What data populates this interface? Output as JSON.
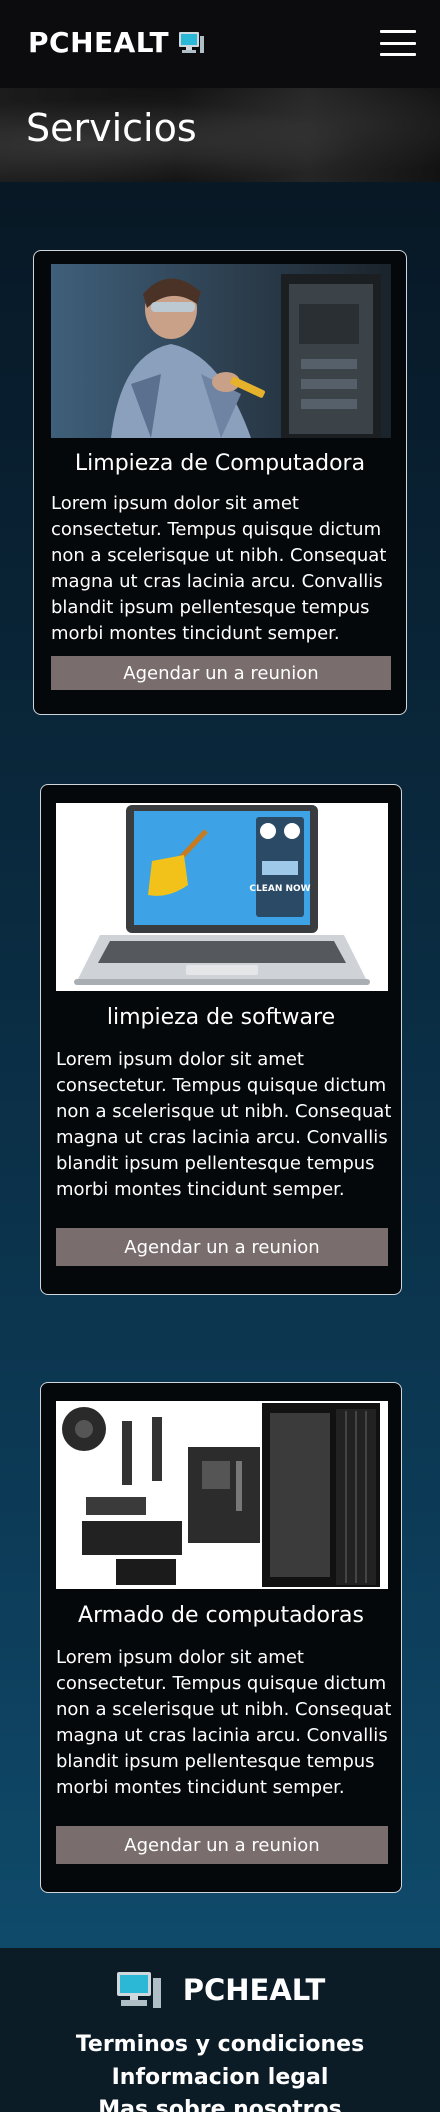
{
  "header": {
    "brand": "PCHEALT",
    "menu_icon": "hamburger-menu-icon"
  },
  "hero": {
    "title": "Servicios"
  },
  "services": [
    {
      "title": "Limpieza de Computadora",
      "text": "Lorem ipsum dolor sit amet consectetur. Tempus quisque dictum non a scelerisque ut nibh. Consequat magna ut cras lacinia arcu. Convallis blandit ipsum pellentesque tempus morbi montes tincidunt semper.",
      "button": "Agendar un a reunion"
    },
    {
      "title": "limpieza de software",
      "text": "Lorem ipsum dolor sit amet consectetur. Tempus quisque dictum non a scelerisque ut nibh. Consequat magna ut cras lacinia arcu. Convallis blandit ipsum pellentesque tempus morbi montes tincidunt semper.",
      "button": "Agendar un a reunion",
      "image_text": "CLEAN NOW"
    },
    {
      "title": "Armado de computadoras",
      "text": "Lorem ipsum dolor sit amet consectetur. Tempus quisque dictum non a scelerisque ut nibh. Consequat magna ut cras lacinia arcu. Convallis blandit ipsum pellentesque tempus morbi montes tincidunt semper.",
      "button": "Agendar un a reunion"
    }
  ],
  "footer": {
    "brand": "PCHEALT",
    "links": [
      "Terminos y condiciones",
      "Informacion legal",
      "Mas sobre nosotros"
    ]
  },
  "colors": {
    "header_bg": "#0c0c0e",
    "card_bg": "#05080b",
    "button_bg": "#7a6d6d",
    "footer_bg": "#0c1c26"
  }
}
